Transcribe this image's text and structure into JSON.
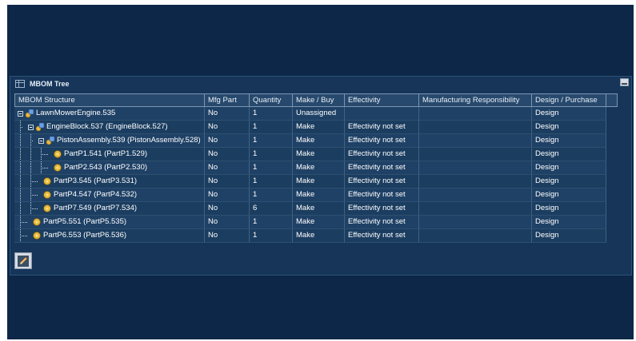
{
  "panel": {
    "title": "MBOM Tree",
    "title_icon": "tree-table-icon",
    "minimize_icon": "minimize-icon",
    "edit_icon": "pencil-edit-icon"
  },
  "columns": [
    "MBOM Structure",
    "Mfg Part",
    "Quantity",
    "Make / Buy",
    "Effectivity",
    "Manufacturing Responsibility",
    "Design / Purchase"
  ],
  "rows": [
    {
      "label": "LawnMowerEngine.535",
      "icon": "assembly-icon",
      "mfg_part": "No",
      "quantity": "1",
      "make_buy": "Unassigned",
      "effectivity": "",
      "mfg_resp": "",
      "design_purchase": "Design"
    },
    {
      "label": "EngineBlock.537 (EngineBlock.527)",
      "icon": "assembly-icon",
      "mfg_part": "No",
      "quantity": "1",
      "make_buy": "Make",
      "effectivity": "Effectivity not set",
      "mfg_resp": "",
      "design_purchase": "Design"
    },
    {
      "label": "PistonAssembly.539 (PistonAssembly.528)",
      "icon": "assembly-icon",
      "mfg_part": "No",
      "quantity": "1",
      "make_buy": "Make",
      "effectivity": "Effectivity not set",
      "mfg_resp": "",
      "design_purchase": "Design"
    },
    {
      "label": "PartP1.541 (PartP1.529)",
      "icon": "part-icon",
      "mfg_part": "No",
      "quantity": "1",
      "make_buy": "Make",
      "effectivity": "Effectivity not set",
      "mfg_resp": "",
      "design_purchase": "Design"
    },
    {
      "label": "PartP2.543 (PartP2.530)",
      "icon": "part-icon",
      "mfg_part": "No",
      "quantity": "1",
      "make_buy": "Make",
      "effectivity": "Effectivity not set",
      "mfg_resp": "",
      "design_purchase": "Design"
    },
    {
      "label": "PartP3.545 (PartP3.531)",
      "icon": "part-icon",
      "mfg_part": "No",
      "quantity": "1",
      "make_buy": "Make",
      "effectivity": "Effectivity not set",
      "mfg_resp": "",
      "design_purchase": "Design"
    },
    {
      "label": "PartP4.547 (PartP4.532)",
      "icon": "part-icon",
      "mfg_part": "No",
      "quantity": "1",
      "make_buy": "Make",
      "effectivity": "Effectivity not set",
      "mfg_resp": "",
      "design_purchase": "Design"
    },
    {
      "label": "PartP7.549 (PartP7.534)",
      "icon": "part-icon",
      "mfg_part": "No",
      "quantity": "6",
      "make_buy": "Make",
      "effectivity": "Effectivity not set",
      "mfg_resp": "",
      "design_purchase": "Design"
    },
    {
      "label": "PartP5.551 (PartP5.535)",
      "icon": "part-icon",
      "mfg_part": "No",
      "quantity": "1",
      "make_buy": "Make",
      "effectivity": "Effectivity not set",
      "mfg_resp": "",
      "design_purchase": "Design"
    },
    {
      "label": "PartP6.553 (PartP6.536)",
      "icon": "part-icon",
      "mfg_part": "No",
      "quantity": "1",
      "make_buy": "Make",
      "effectivity": "Effectivity not set",
      "mfg_resp": "",
      "design_purchase": "Design"
    }
  ]
}
